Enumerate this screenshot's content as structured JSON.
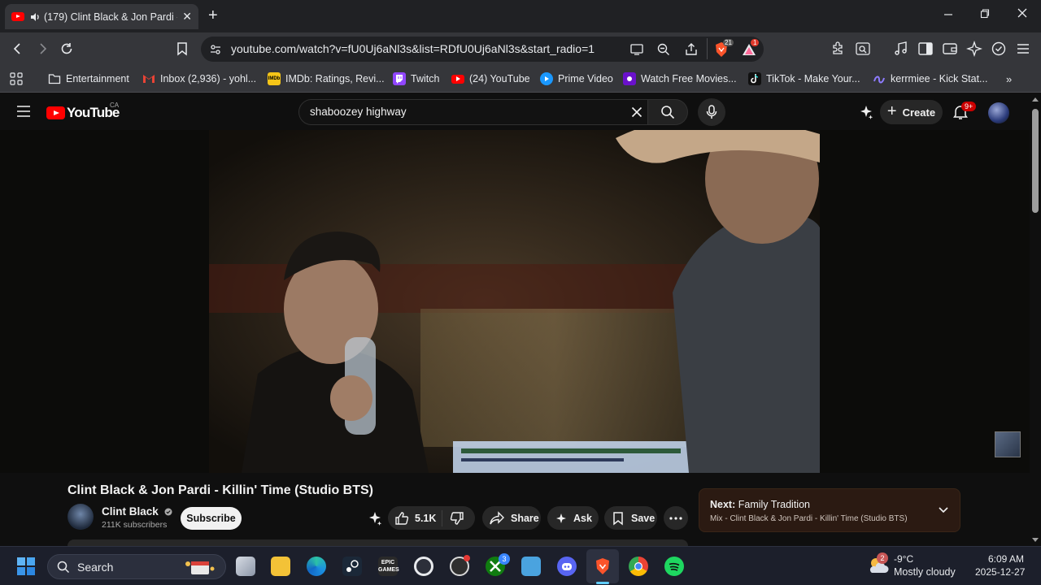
{
  "browser": {
    "tab_title": "(179) Clint Black & Jon Pardi -",
    "url": "youtube.com/watch?v=fU0Uj6aNl3s&list=RDfU0Uj6aNl3s&start_radio=1",
    "brave_shield_count": "21",
    "rewards_badge": "1"
  },
  "bookmarks": [
    {
      "label": "Entertainment",
      "icon": "folder-icon"
    },
    {
      "label": "Inbox (2,936) - yohl...",
      "icon": "gmail-icon",
      "color": "#ea4335"
    },
    {
      "label": "IMDb: Ratings, Revi...",
      "icon": "imdb-icon",
      "color": "#f5c518",
      "glyph": "IMDb"
    },
    {
      "label": "Twitch",
      "icon": "twitch-icon",
      "color": "#9146ff"
    },
    {
      "label": "(24) YouTube",
      "icon": "youtube-icon",
      "color": "#ff0000"
    },
    {
      "label": "Prime Video",
      "icon": "prime-video-icon",
      "color": "#1a98ff"
    },
    {
      "label": "Watch Free Movies...",
      "icon": "movies-icon",
      "color": "#6a11cb"
    },
    {
      "label": "TikTok - Make Your...",
      "icon": "tiktok-icon",
      "color": "#111111"
    },
    {
      "label": "kerrmiee - Kick Stat...",
      "icon": "kick-stats-icon",
      "color": "#8e7cff"
    }
  ],
  "youtube": {
    "logo_text": "YouTube",
    "region": "CA",
    "search_query": "shaboozey highway",
    "create_label": "Create",
    "notif_count": "9+"
  },
  "video": {
    "title": "Clint Black & Jon Pardi - Killin' Time (Studio BTS)",
    "channel": "Clint Black",
    "subscribers": "211K subscribers",
    "subscribe_label": "Subscribe",
    "likes": "5.1K",
    "share_label": "Share",
    "ask_label": "Ask",
    "save_label": "Save"
  },
  "next_up": {
    "prefix": "Next:",
    "title": "Family Tradition",
    "subtitle": "Mix - Clint Black & Jon Pardi - Killin' Time (Studio BTS)"
  },
  "taskbar": {
    "search_label": "Search",
    "xbox_badge": "3",
    "weather_badge": "2",
    "temperature": "-9°C",
    "weather": "Mostly cloudy",
    "time": "6:09 AM",
    "date": "2025-12-27"
  }
}
